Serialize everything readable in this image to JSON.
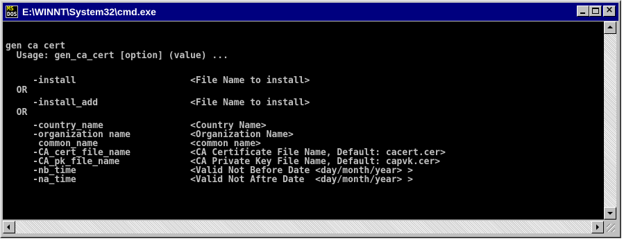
{
  "window": {
    "title": "E:\\WINNT\\System32\\cmd.exe",
    "icon": "ms-dos-icon",
    "colors": {
      "titlebar": "#00007f",
      "console_bg": "#000000",
      "console_fg": "#c0c0c0"
    }
  },
  "console": {
    "lines": [
      "gen ca cert",
      "  Usage: gen_ca_cert [option] (value) ...",
      "",
      "     -install                     <File Name to install>",
      "  OR",
      "     -install_add                 <File Name to install>",
      "  OR",
      "     -country_name                <Country Name>",
      "     -organization name           <Organization Name>",
      "      common_name                 <common name>",
      "     -CA_cert_file_name           <CA Certificate File Name, Default: cacert.cer>",
      "     -CA_pk_file_name             <CA Private Key File Name, Default: capvk.cer>",
      "     -nb_time                     <Valid Not Before Date <day/month/year> >",
      "     -na_time                     <Valid Not Aftre Date  <day/month/year> >"
    ]
  }
}
